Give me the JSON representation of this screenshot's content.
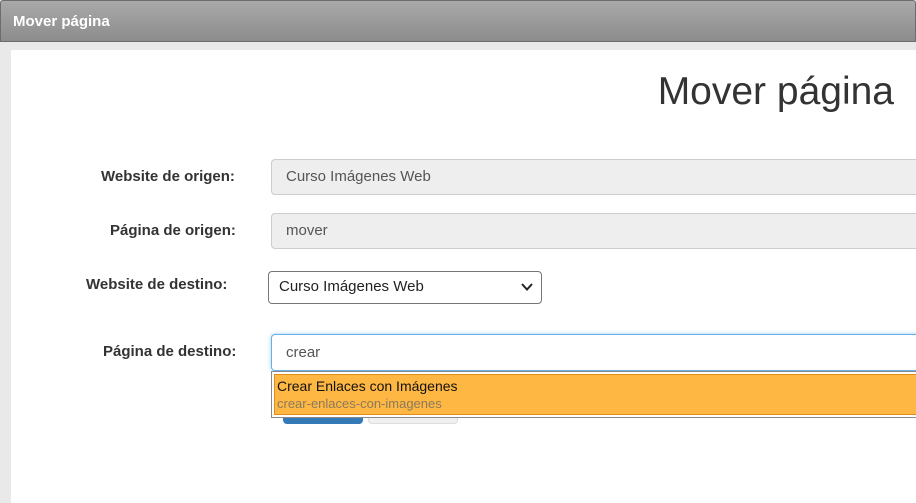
{
  "window": {
    "title": "Mover página"
  },
  "page": {
    "heading": "Mover página"
  },
  "form": {
    "source_website": {
      "label": "Website de origen:",
      "value": "Curso Imágenes Web"
    },
    "source_page": {
      "label": "Página de origen:",
      "value": "mover"
    },
    "target_website": {
      "label": "Website de destino:",
      "selected": "Curso Imágenes Web"
    },
    "target_page": {
      "label": "Página de destino:",
      "value": "crear"
    }
  },
  "autocomplete": {
    "items": [
      {
        "title": "Crear Enlaces con Imágenes",
        "slug": "crear-enlaces-con-imagenes",
        "highlighted": true
      }
    ],
    "highlight_color": "#ffb743"
  },
  "icons": {
    "select_arrow": "chevron-down-icon"
  }
}
